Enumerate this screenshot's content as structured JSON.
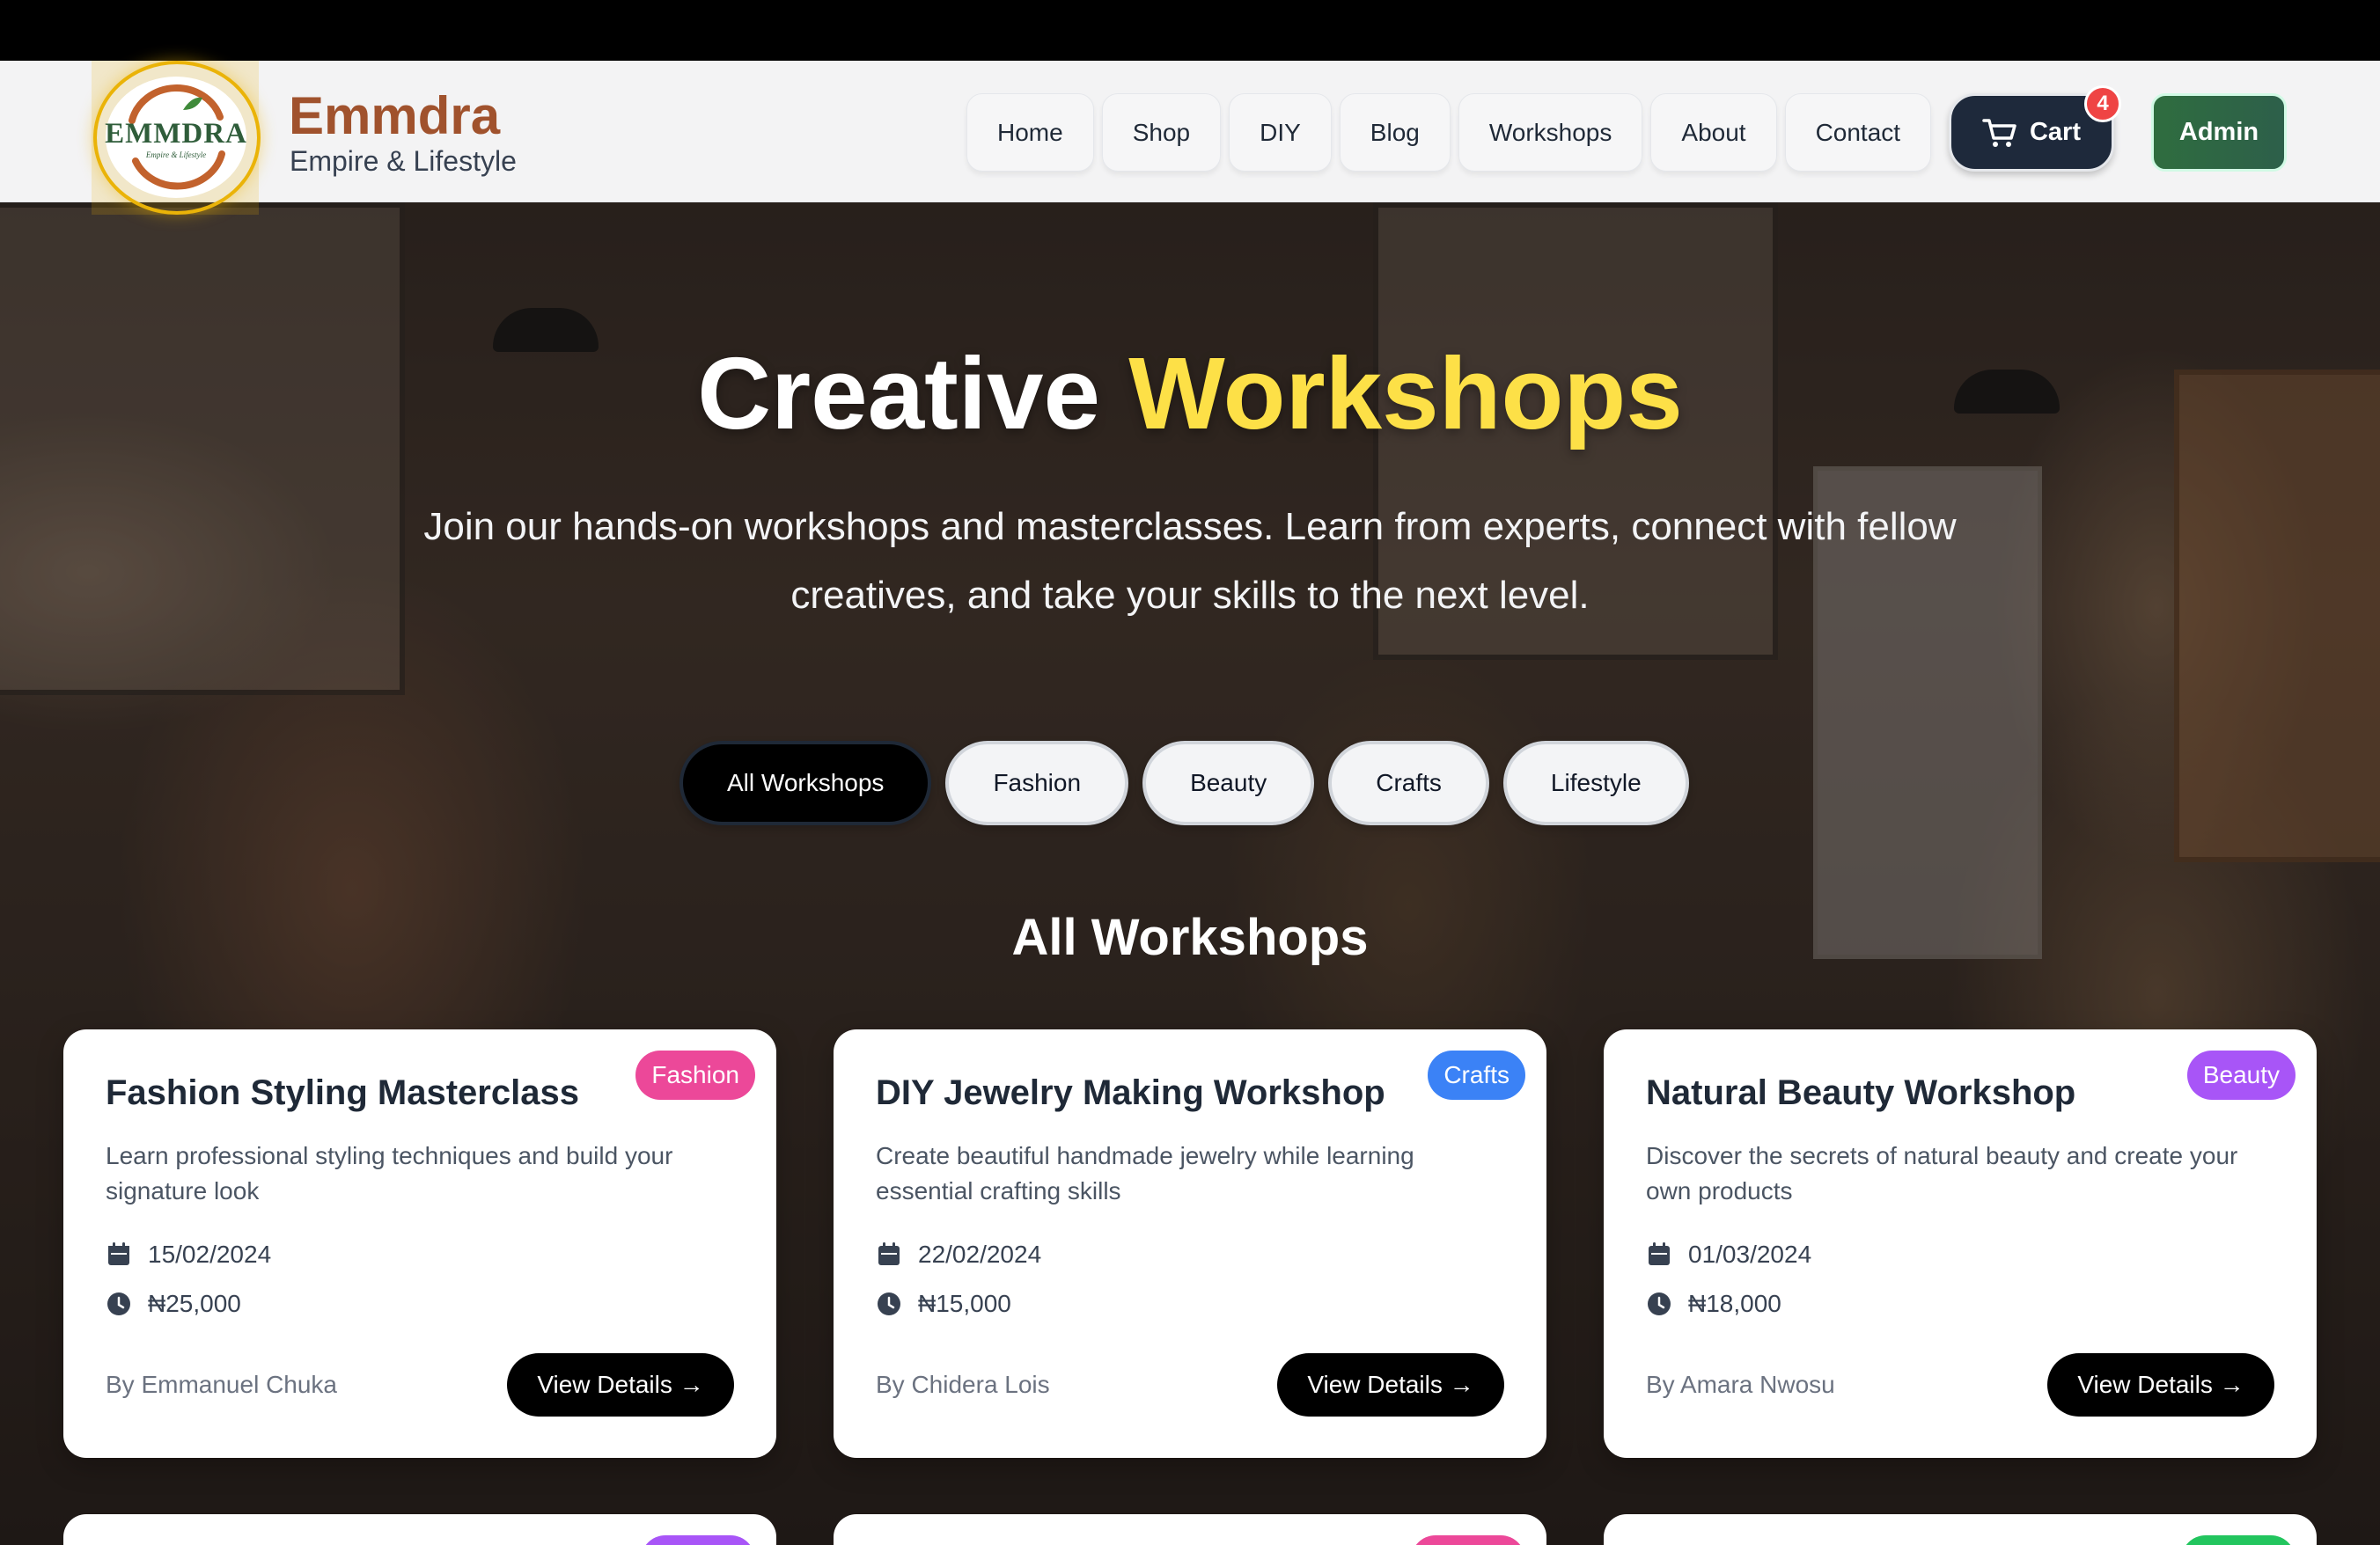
{
  "brand": {
    "logo_text": "EMMDRA",
    "logo_subtext": "Empire & Lifestyle",
    "name": "Emmdra",
    "tagline": "Empire & Lifestyle"
  },
  "nav": {
    "items": [
      "Home",
      "Shop",
      "DIY",
      "Blog",
      "Workshops",
      "About",
      "Contact"
    ],
    "cart_label": "Cart",
    "cart_count": "4",
    "admin_label": "Admin"
  },
  "hero": {
    "title_main": "Creative",
    "title_accent": "Workshops",
    "subtitle": "Join our hands-on workshops and masterclasses. Learn from experts, connect with fellow creatives, and take your skills to the next level."
  },
  "filters": {
    "active": "All Workshops",
    "items": [
      "All Workshops",
      "Fashion",
      "Beauty",
      "Crafts",
      "Lifestyle"
    ]
  },
  "section_title": "All Workshops",
  "cards": [
    {
      "title": "Fashion Styling Masterclass",
      "category": "Fashion",
      "category_color": "#ec4899",
      "description": "Learn professional styling techniques and build your signature look",
      "date": "15/02/2024",
      "price": "₦25,000",
      "author": "By Emmanuel Chuka",
      "button": "View Details →"
    },
    {
      "title": "DIY Jewelry Making Workshop",
      "category": "Crafts",
      "category_color": "#3b82f6",
      "description": "Create beautiful handmade jewelry while learning essential crafting skills",
      "date": "22/02/2024",
      "price": "₦15,000",
      "author": "By Chidera Lois",
      "button": "View Details →"
    },
    {
      "title": "Natural Beauty Workshop",
      "category": "Beauty",
      "category_color": "#a855f7",
      "description": "Discover the secrets of natural beauty and create your own products",
      "date": "01/03/2024",
      "price": "₦18,000",
      "author": "By Amara Nwosu",
      "button": "View Details →"
    }
  ],
  "next_row_badge_colors": [
    "#a855f7",
    "#ec4899",
    "#22c55e"
  ],
  "icons": {
    "cart": "shopping-cart-icon",
    "date": "calendar-icon",
    "price": "clock-icon"
  }
}
